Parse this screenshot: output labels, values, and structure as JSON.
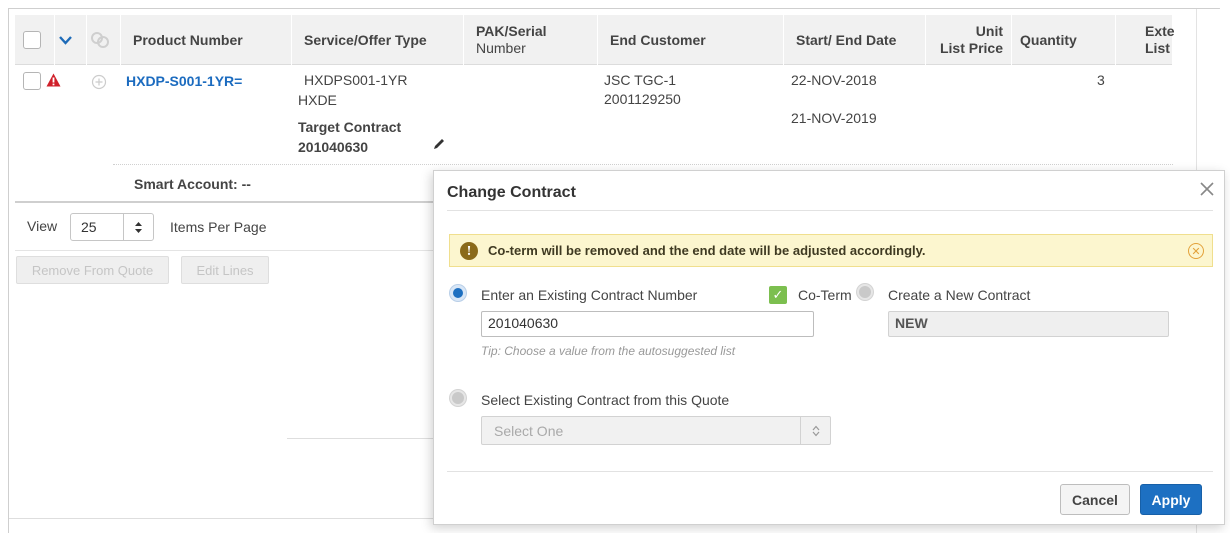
{
  "table": {
    "headers": {
      "product_number": "Product Number",
      "service_type": "Service/Offer Type",
      "pak_line1": "PAK/Serial",
      "pak_line2": "Number",
      "end_customer": "End Customer",
      "dates": "Start/ End Date",
      "unit_line1": "Unit",
      "unit_line2": "List Price",
      "quantity": "Quantity",
      "ext_line1": "Exte",
      "ext_line2": "List"
    },
    "row": {
      "product_number": "HXDP-S001-1YR=",
      "service_code": "HXDPS001-1YR",
      "service_type": "HXDE",
      "target_label": "Target Contract",
      "target_value": "201040630",
      "customer_name": "JSC TGC-1",
      "customer_id": "2001129250",
      "start_date": "22-NOV-2018",
      "end_date": "21-NOV-2019",
      "quantity": "3",
      "smart_account": "Smart Account: --"
    }
  },
  "pager": {
    "view_label": "View",
    "page_size": "25",
    "items_label": "Items Per Page"
  },
  "actions": {
    "remove": "Remove From Quote",
    "edit": "Edit Lines"
  },
  "modal": {
    "title": "Change Contract",
    "alert": "Co-term will be removed and the end date will be adjusted accordingly.",
    "option_existing": "Enter an Existing Contract Number",
    "existing_value": "201040630",
    "tip_prefix": "Tip:",
    "tip_text": "Choose a value from the autosuggested list",
    "coterm_label": "Co-Term",
    "option_new": "Create a New Contract",
    "new_value": "NEW",
    "option_select": "Select Existing Contract from this Quote",
    "select_placeholder": "Select One",
    "cancel": "Cancel",
    "apply": "Apply"
  },
  "colors": {
    "accent": "#1d70c2",
    "link": "#1b6bbf",
    "alert_bg": "#fcf6cf",
    "warning": "#d0202a",
    "check": "#7cbf4f"
  }
}
